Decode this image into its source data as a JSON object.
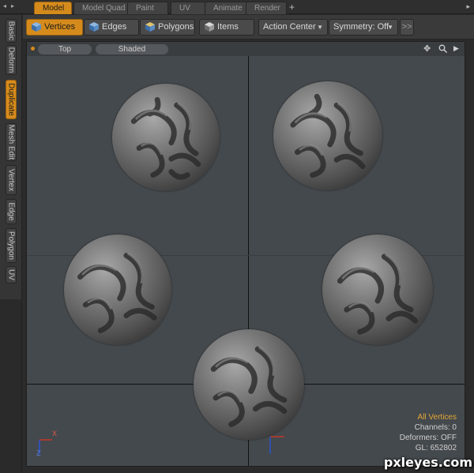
{
  "tabs": [
    {
      "label": "Model",
      "active": true
    },
    {
      "label": "Model Quad",
      "active": false
    },
    {
      "label": "Paint",
      "active": false
    },
    {
      "label": "UV",
      "active": false
    },
    {
      "label": "Animate",
      "active": false
    },
    {
      "label": "Render",
      "active": false
    }
  ],
  "tab_add": "+",
  "left_tabs": [
    {
      "label": "Basic",
      "active": false
    },
    {
      "label": "Deform",
      "active": false
    },
    {
      "label": "Duplicate",
      "active": true
    },
    {
      "label": "Mesh Edit",
      "active": false
    },
    {
      "label": "Vertex",
      "active": false
    },
    {
      "label": "Edge",
      "active": false
    },
    {
      "label": "Polygon",
      "active": false
    },
    {
      "label": "UV",
      "active": false
    }
  ],
  "toolbar": {
    "vertices": "Vertices",
    "edges": "Edges",
    "polygons": "Polygons",
    "items": "Items",
    "action_center": "Action Center",
    "symmetry": "Symmetry: Off",
    "more": ">>"
  },
  "viewport": {
    "view": "Top",
    "shading": "Shaded",
    "icons": [
      "move-icon",
      "zoom-icon",
      "play-icon"
    ]
  },
  "info": {
    "selection": "All Vertices",
    "channels": "Channels: 0",
    "deformers": "Deformers: OFF",
    "gl": "GL: 652802"
  },
  "axis": {
    "x_label": "X",
    "z_label": "Z"
  },
  "watermark": "pxleyes.com",
  "colors": {
    "accent": "#d58b1c",
    "viewport_bg": "#44494d",
    "info_accent": "#e3a63a"
  }
}
